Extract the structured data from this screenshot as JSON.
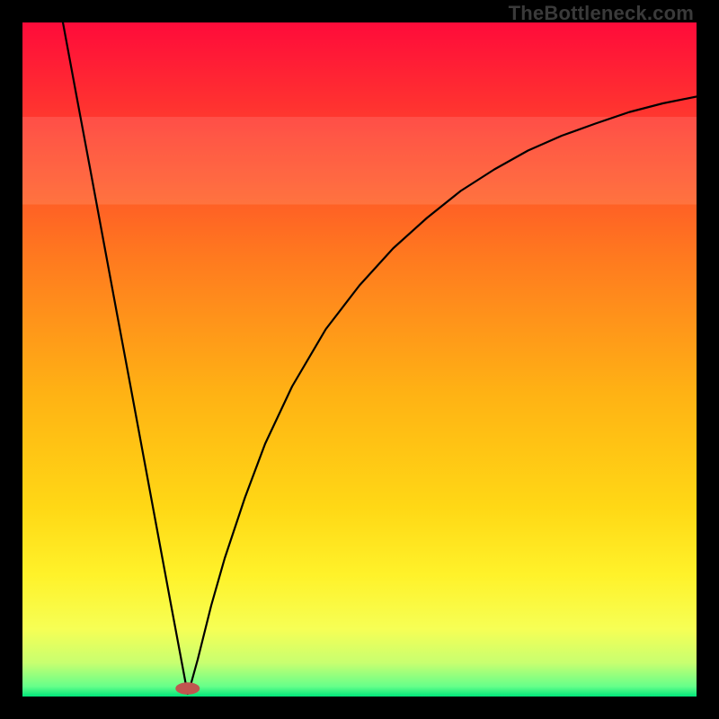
{
  "watermark": "TheBottleneck.com",
  "chart_data": {
    "type": "line",
    "title": "",
    "xlabel": "",
    "ylabel": "",
    "xlim": [
      0,
      100
    ],
    "ylim": [
      0,
      100
    ],
    "grid": false,
    "legend": false,
    "background_gradient": {
      "direction": "vertical",
      "stops": [
        {
          "pos": 0.0,
          "color": "#ff0b3a"
        },
        {
          "pos": 0.15,
          "color": "#ff3a2e"
        },
        {
          "pos": 0.35,
          "color": "#ff7a1f"
        },
        {
          "pos": 0.55,
          "color": "#ffb214"
        },
        {
          "pos": 0.72,
          "color": "#ffd815"
        },
        {
          "pos": 0.82,
          "color": "#fff22a"
        },
        {
          "pos": 0.9,
          "color": "#f6ff55"
        },
        {
          "pos": 0.95,
          "color": "#c8ff70"
        },
        {
          "pos": 0.985,
          "color": "#66ff8a"
        },
        {
          "pos": 1.0,
          "color": "#00e57a"
        }
      ]
    },
    "haze_band": {
      "y_from": 73,
      "y_to": 86,
      "color": "#ffffff",
      "opacity": 0.12
    },
    "marker": {
      "x": 24.5,
      "y": 1.2,
      "color": "#c0564f",
      "rx": 1.8,
      "ry": 0.9
    },
    "series": [
      {
        "name": "curve",
        "stroke": "#000000",
        "stroke_width": 2.2,
        "points": [
          {
            "x": 6.0,
            "y": 100.0
          },
          {
            "x": 8.0,
            "y": 89.2
          },
          {
            "x": 10.0,
            "y": 78.5
          },
          {
            "x": 12.0,
            "y": 67.7
          },
          {
            "x": 14.0,
            "y": 56.9
          },
          {
            "x": 16.0,
            "y": 46.2
          },
          {
            "x": 18.0,
            "y": 35.4
          },
          {
            "x": 20.0,
            "y": 24.6
          },
          {
            "x": 22.0,
            "y": 13.8
          },
          {
            "x": 24.0,
            "y": 3.1
          },
          {
            "x": 24.5,
            "y": 0.4
          },
          {
            "x": 25.0,
            "y": 1.9
          },
          {
            "x": 26.0,
            "y": 5.5
          },
          {
            "x": 28.0,
            "y": 13.5
          },
          {
            "x": 30.0,
            "y": 20.5
          },
          {
            "x": 33.0,
            "y": 29.5
          },
          {
            "x": 36.0,
            "y": 37.5
          },
          {
            "x": 40.0,
            "y": 46.0
          },
          {
            "x": 45.0,
            "y": 54.5
          },
          {
            "x": 50.0,
            "y": 61.0
          },
          {
            "x": 55.0,
            "y": 66.5
          },
          {
            "x": 60.0,
            "y": 71.0
          },
          {
            "x": 65.0,
            "y": 75.0
          },
          {
            "x": 70.0,
            "y": 78.2
          },
          {
            "x": 75.0,
            "y": 81.0
          },
          {
            "x": 80.0,
            "y": 83.2
          },
          {
            "x": 85.0,
            "y": 85.0
          },
          {
            "x": 90.0,
            "y": 86.7
          },
          {
            "x": 95.0,
            "y": 88.0
          },
          {
            "x": 100.0,
            "y": 89.0
          }
        ]
      }
    ]
  }
}
